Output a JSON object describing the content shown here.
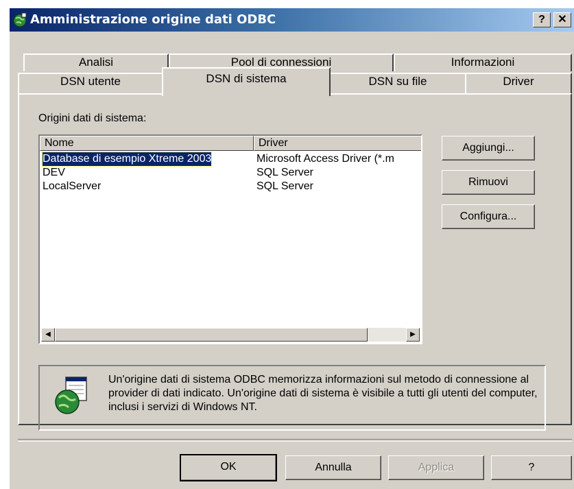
{
  "window": {
    "title": "Amministrazione origine dati ODBC",
    "help_label": "?",
    "close_label": "✕"
  },
  "tabs": {
    "row1": [
      {
        "label": "Analisi"
      },
      {
        "label": "Pool di connessioni"
      },
      {
        "label": "Informazioni"
      }
    ],
    "row2": [
      {
        "label": "DSN utente"
      },
      {
        "label": "DSN di sistema",
        "active": true
      },
      {
        "label": "DSN su file"
      },
      {
        "label": "Driver"
      }
    ]
  },
  "panel": {
    "list_label": "Origini dati di sistema:",
    "columns": [
      "Nome",
      "Driver"
    ],
    "rows": [
      {
        "name": "Database di esempio Xtreme 2003",
        "driver": "Microsoft Access Driver (*.m"
      },
      {
        "name": "DEV",
        "driver": "SQL Server"
      },
      {
        "name": "LocalServer",
        "driver": "SQL Server"
      }
    ],
    "buttons": {
      "add": "Aggiungi...",
      "remove": "Rimuovi",
      "configure": "Configura..."
    },
    "info_text": "Un'origine dati di sistema ODBC memorizza informazioni sul metodo di connessione al provider di dati indicato. Un'origine dati di sistema è visibile a tutti gli utenti del computer, inclusi i servizi di Windows NT."
  },
  "footer": {
    "ok": "OK",
    "cancel": "Annulla",
    "apply": "Applica",
    "help": "?"
  },
  "colors": {
    "title_start": "#0a246a",
    "title_end": "#a6caf0",
    "face": "#d4d0c8",
    "selection": "#0a246a"
  }
}
